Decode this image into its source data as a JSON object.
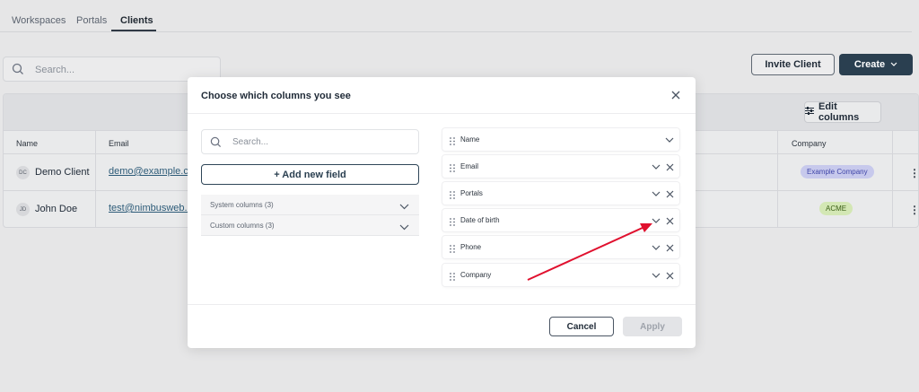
{
  "tabs": [
    {
      "label": "Workspaces"
    },
    {
      "label": "Portals"
    },
    {
      "label": "Clients"
    }
  ],
  "active_tab": "Clients",
  "search": {
    "placeholder": "Search..."
  },
  "header_buttons": {
    "invite": "Invite Client",
    "create": "Create"
  },
  "table": {
    "edit_columns_label": "Edit columns",
    "headers": {
      "name": "Name",
      "email": "Email",
      "company": "Company"
    },
    "rows": [
      {
        "initials": "DC",
        "name": "Demo Client",
        "email": "demo@example.com",
        "company": "Example Company",
        "company_color": "#c7c9ec",
        "company_text_color": "#3f45a8"
      },
      {
        "initials": "JD",
        "name": "John Doe",
        "email": "test@nimbusweb.co",
        "company": "ACME",
        "company_color": "#d3e7b4",
        "company_text_color": "#3c5f17"
      }
    ]
  },
  "modal": {
    "title": "Choose which columns you see",
    "search_placeholder": "Search...",
    "add_field_label": "+ Add new field",
    "groups": [
      {
        "label": "System columns (3)"
      },
      {
        "label": "Custom columns (3)"
      }
    ],
    "columns": [
      {
        "label": "Name",
        "removable": false
      },
      {
        "label": "Email",
        "removable": true
      },
      {
        "label": "Portals",
        "removable": true
      },
      {
        "label": "Date of birth",
        "removable": true
      },
      {
        "label": "Phone",
        "removable": true
      },
      {
        "label": "Company",
        "removable": true
      }
    ],
    "cancel_label": "Cancel",
    "apply_label": "Apply"
  },
  "colors": {
    "primary": "#2a3f50",
    "annotation_arrow": "#e0102e"
  }
}
